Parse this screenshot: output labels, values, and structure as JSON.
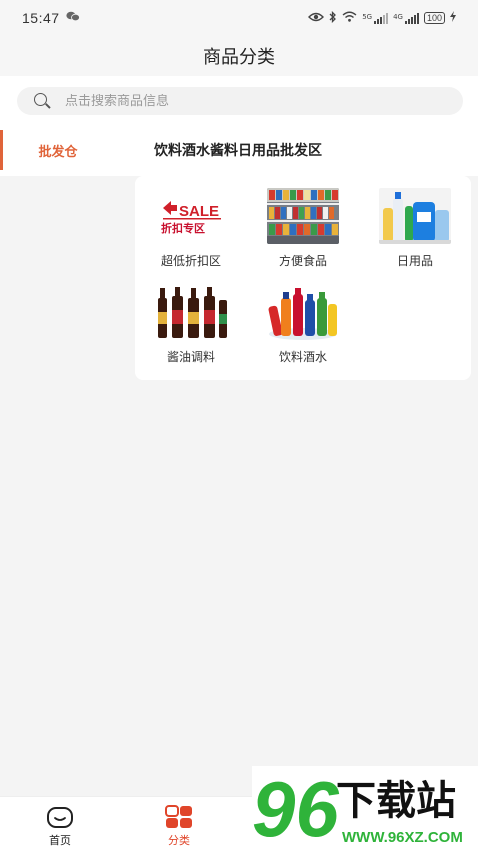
{
  "status_bar": {
    "time": "15:47",
    "net1": "5G",
    "net2": "4G",
    "battery": "100"
  },
  "header": {
    "title": "商品分类"
  },
  "search": {
    "placeholder": "点击搜索商品信息"
  },
  "sidebar": {
    "items": [
      {
        "label": "批发仓",
        "active": true
      }
    ]
  },
  "content": {
    "section_title": "饮料酒水酱料日用品批发区",
    "categories": [
      {
        "label": "超低折扣区",
        "image": "sale-banner"
      },
      {
        "label": "方便食品",
        "image": "supermarket-shelves"
      },
      {
        "label": "日用品",
        "image": "daily-goods-bottles"
      },
      {
        "label": "酱油调料",
        "image": "soy-sauce-bottles"
      },
      {
        "label": "饮料酒水",
        "image": "drink-bottles"
      }
    ],
    "sale_banner_text": {
      "big": "SALE",
      "small": "折扣专区"
    }
  },
  "bottom_nav": {
    "items": [
      {
        "label": "首页",
        "icon": "home-face-icon",
        "active": false
      },
      {
        "label": "分类",
        "icon": "category-grid-icon",
        "active": true
      }
    ]
  },
  "watermark": {
    "main": "96下载站",
    "url": "WWW.96XZ.COM"
  },
  "colors": {
    "accent": "#e0643a",
    "watermark_green": "#2fb33a",
    "text": "#333333"
  }
}
